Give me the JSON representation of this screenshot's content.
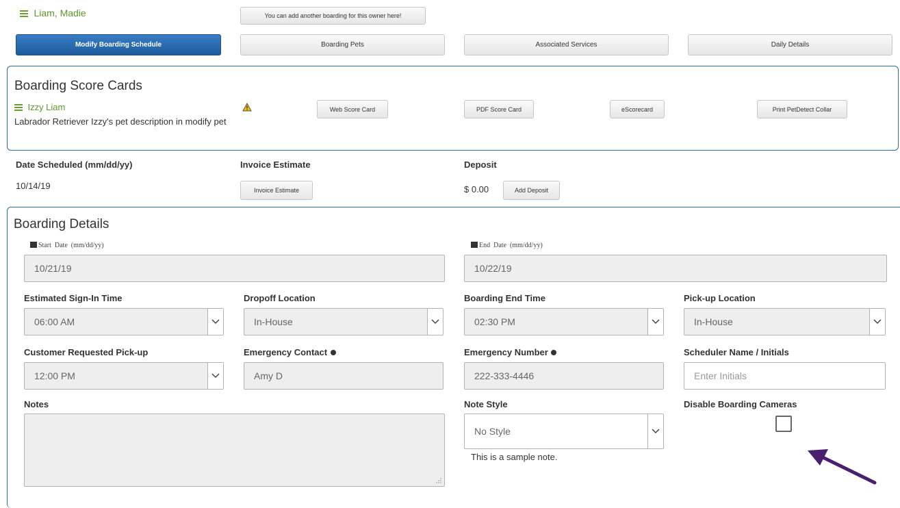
{
  "owner": {
    "name": "Liam, Madie"
  },
  "add_boarding_button": "You can add another boarding for this owner here!",
  "tabs": [
    {
      "label": "Modify Boarding Schedule",
      "active": true
    },
    {
      "label": "Boarding Pets"
    },
    {
      "label": "Associated Services"
    },
    {
      "label": "Daily Details"
    }
  ],
  "score_cards": {
    "title": "Boarding Score Cards",
    "pet_name": "Izzy Liam",
    "pet_description": "Labrador Retriever Izzy's pet description in modify pet",
    "buttons": {
      "web": "Web Score Card",
      "pdf": "PDF Score Card",
      "escorecard": "eScorecard",
      "print_collar": "Print PetDetect Collar"
    }
  },
  "summary": {
    "date_scheduled_label": "Date Scheduled (mm/dd/yy)",
    "date_scheduled_value": "10/14/19",
    "invoice_label": "Invoice Estimate",
    "invoice_button": "Invoice Estimate",
    "deposit_label": "Deposit",
    "deposit_value": "$ 0.00",
    "add_deposit_button": "Add Deposit"
  },
  "details": {
    "title": "Boarding Details",
    "start_date": {
      "label_start": "Start",
      "label_date": "Date",
      "label_fmt": "(mm/dd/yy)",
      "value": "10/21/19"
    },
    "end_date": {
      "label_start": "End",
      "label_date": "Date",
      "label_fmt": "(mm/dd/yy)",
      "value": "10/22/19"
    },
    "signin_time": {
      "label": "Estimated Sign-In Time",
      "value": "06:00 AM"
    },
    "dropoff_location": {
      "label": "Dropoff Location",
      "value": "In-House"
    },
    "end_time": {
      "label": "Boarding End Time",
      "value": "02:30 PM"
    },
    "pickup_location": {
      "label": "Pick-up Location",
      "value": "In-House"
    },
    "customer_pickup": {
      "label": "Customer Requested Pick-up",
      "value": "12:00 PM"
    },
    "emergency_contact": {
      "label": "Emergency Contact",
      "value": "Amy D"
    },
    "emergency_number": {
      "label": "Emergency Number",
      "value": "222-333-4446"
    },
    "scheduler": {
      "label": "Scheduler Name / Initials",
      "placeholder": "Enter Initials"
    },
    "notes": {
      "label": "Notes",
      "value": ""
    },
    "note_style": {
      "label": "Note Style",
      "value": "No Style",
      "sample": "This is a sample note."
    },
    "disable_cameras": {
      "label": "Disable Boarding Cameras",
      "checked": false
    }
  },
  "colors": {
    "accent": "#1d5c9e",
    "green": "#5a9a2a",
    "panel_border": "#2a6d8f",
    "arrow": "#4b1f6f"
  }
}
